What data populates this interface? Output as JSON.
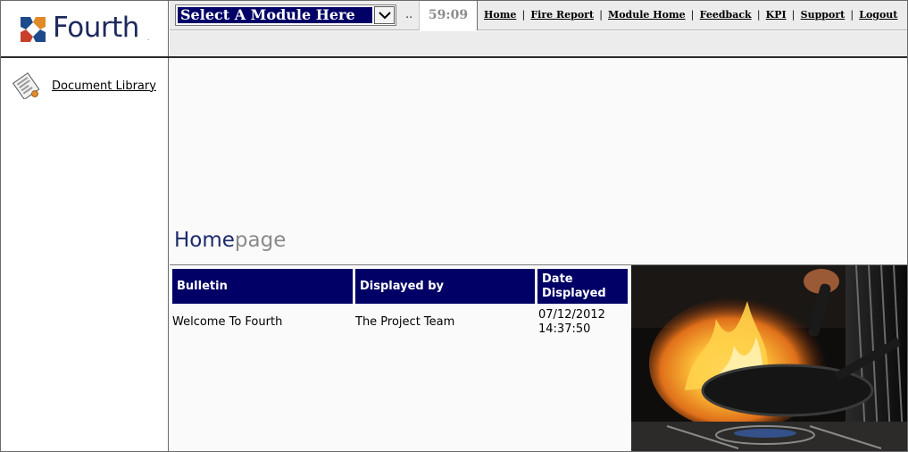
{
  "brand": {
    "name": "Fourth",
    "trademark": ".",
    "colors": {
      "navy": "#1c2a5c",
      "header_blue": "#000066"
    }
  },
  "topbar": {
    "module_select": {
      "selected": "Select A Module Here",
      "icon": "chevron-down-icon"
    },
    "ellipsis": "..",
    "timer": "59:09",
    "links": [
      {
        "label": "Home"
      },
      {
        "label": "Fire Report"
      },
      {
        "label": "Module Home"
      },
      {
        "label": "Feedback"
      },
      {
        "label": "KPI"
      },
      {
        "label": "Support"
      },
      {
        "label": "Logout"
      }
    ],
    "separator": "|"
  },
  "sidebar": {
    "items": [
      {
        "label": "Document Library",
        "icon": "document-library-icon"
      }
    ]
  },
  "main": {
    "title_part1": "Home",
    "title_part2": "page",
    "bulletin_table": {
      "headers": [
        "Bulletin",
        "Displayed by",
        "Date Displayed"
      ],
      "rows": [
        {
          "bulletin": "Welcome To Fourth",
          "displayed_by": "The Project Team",
          "date": "07/12/2012",
          "time": "14:37:50"
        }
      ]
    }
  }
}
